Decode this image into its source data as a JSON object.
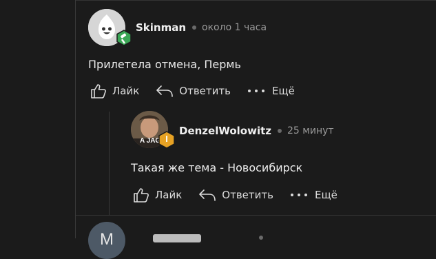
{
  "comments": [
    {
      "author": "Skinman",
      "time": "около 1 часа",
      "text": "Прилетела отмена, Пермь",
      "actions": {
        "like": "Лайк",
        "reply": "Ответить",
        "more": "Ещё"
      },
      "icons": {
        "like": "thumbs-up-icon",
        "reply": "reply-arrow-icon",
        "more": "more-dots-icon",
        "badge": "hammer-badge-icon"
      },
      "colors": {
        "badge": "#3aa655"
      }
    },
    {
      "author": "DenzelWolowitz",
      "time": "25 минут",
      "text": "Такая же тема - Новосибирск",
      "avatar_caption": "A JAG",
      "badge_text": "I",
      "actions": {
        "like": "Лайк",
        "reply": "Ответить",
        "more": "Ещё"
      },
      "icons": {
        "like": "thumbs-up-icon",
        "reply": "reply-arrow-icon",
        "more": "more-dots-icon",
        "badge": "level-badge-icon"
      },
      "colors": {
        "badge": "#e7a224"
      }
    },
    {
      "avatar_letter": "M"
    }
  ]
}
